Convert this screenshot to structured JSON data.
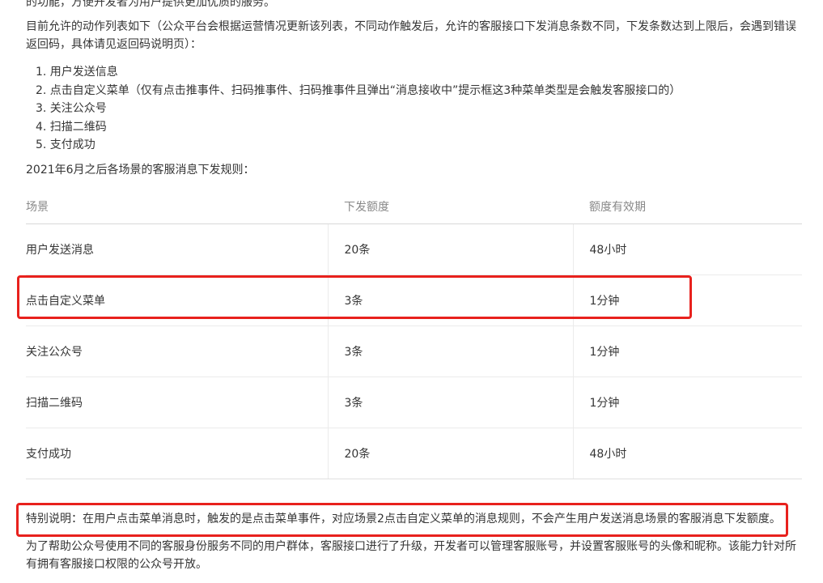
{
  "intro_top": "的功能，方便开发者为用户提供更加优质的服务。",
  "intro": "目前允许的动作列表如下（公众平台会根据运营情况更新该列表，不同动作触发后，允许的客服接口下发消息条数不同，下发条数达到上限后，会遇到错误返回码，具体请见返回码说明页）：",
  "actions": [
    "1. 用户发送信息",
    "2. 点击自定义菜单（仅有点击推事件、扫码推事件、扫码推事件且弹出“消息接收中”提示框这3种菜单类型是会触发客服接口的）",
    "3. 关注公众号",
    "4. 扫描二维码",
    "5. 支付成功"
  ],
  "rules_title": "2021年6月之后各场景的客服消息下发规则：",
  "table": {
    "headers": [
      "场景",
      "下发额度",
      "额度有效期"
    ],
    "rows": [
      [
        "用户发送消息",
        "20条",
        "48小时"
      ],
      [
        "点击自定义菜单",
        "3条",
        "1分钟"
      ],
      [
        "关注公众号",
        "3条",
        "1分钟"
      ],
      [
        "扫描二维码",
        "3条",
        "1分钟"
      ],
      [
        "支付成功",
        "20条",
        "48小时"
      ]
    ]
  },
  "special_note": "特别说明：在用户点击菜单消息时，触发的是点击菜单事件，对应场景2点击自定义菜单的消息规则，不会产生用户发送消息场景的客服消息下发额度。",
  "outro": "为了帮助公众号使用不同的客服身份服务不同的用户群体，客服接口进行了升级，开发者可以管理客服账号，并设置客服账号的头像和昵称。该能力针对所有拥有客服接口权限的公众号开放。",
  "highlight_color": "#e8211d"
}
